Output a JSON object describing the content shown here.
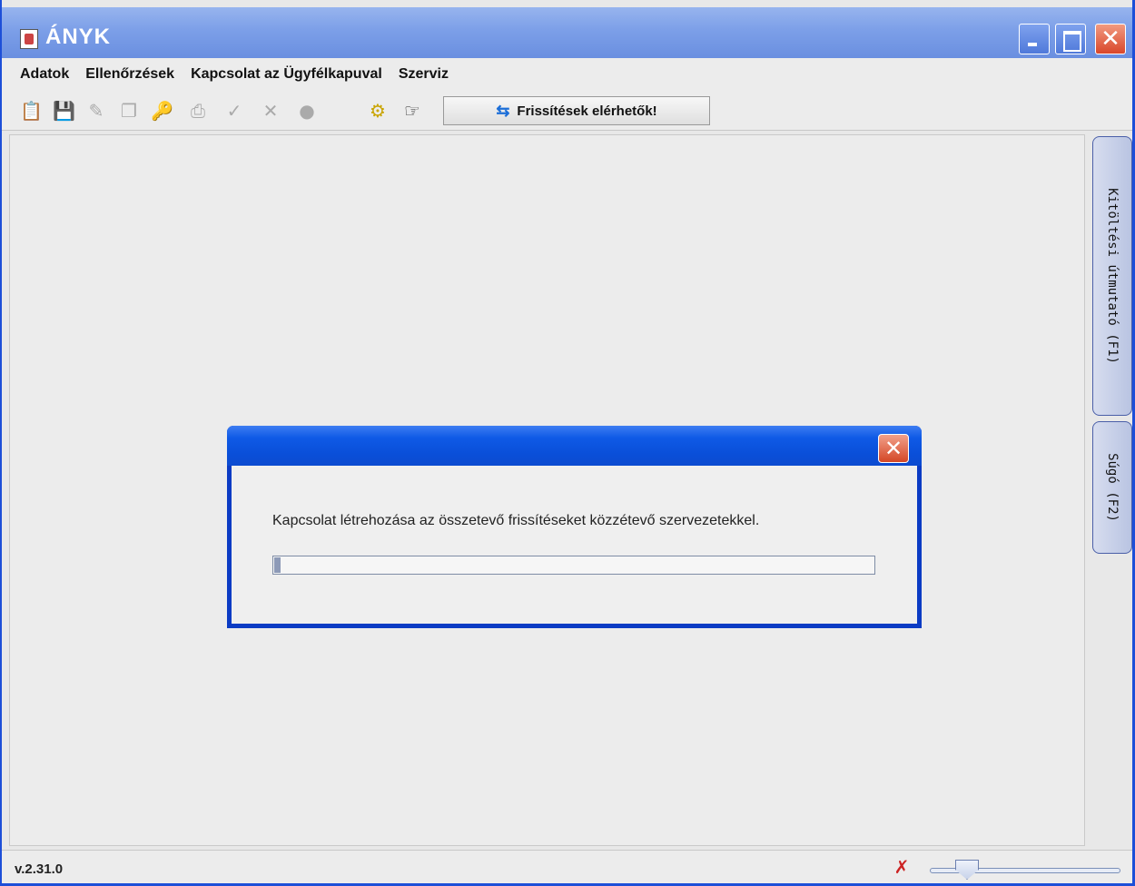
{
  "window": {
    "title": "ÁNYK"
  },
  "menubar": {
    "items": [
      "Adatok",
      "Ellenőrzések",
      "Kapcsolat az Ügyfélkapuval",
      "Szerviz"
    ]
  },
  "toolbar": {
    "update_button_label": "Frissítések elérhetők!",
    "icons": [
      "open-icon",
      "save-icon",
      "edit-icon",
      "copy-icon",
      "key-icon",
      "print-icon",
      "check-icon",
      "delete-icon",
      "globe-icon",
      "settings-icon",
      "pointer-icon"
    ]
  },
  "sidetabs": {
    "guide": "Kitöltési útmutató (F1)",
    "help": "Súgó (F2)"
  },
  "dialog": {
    "message": "Kapcsolat létrehozása az összetevő frissítéseket közzétevő szervezetekkel.",
    "progress": 0.01
  },
  "statusbar": {
    "version": "v.2.31.0",
    "zoom_level": 0.15
  },
  "colors": {
    "titlebar": "#7c9fe8",
    "dialog_titlebar": "#0a4fd9",
    "close_button": "#d9472b"
  }
}
